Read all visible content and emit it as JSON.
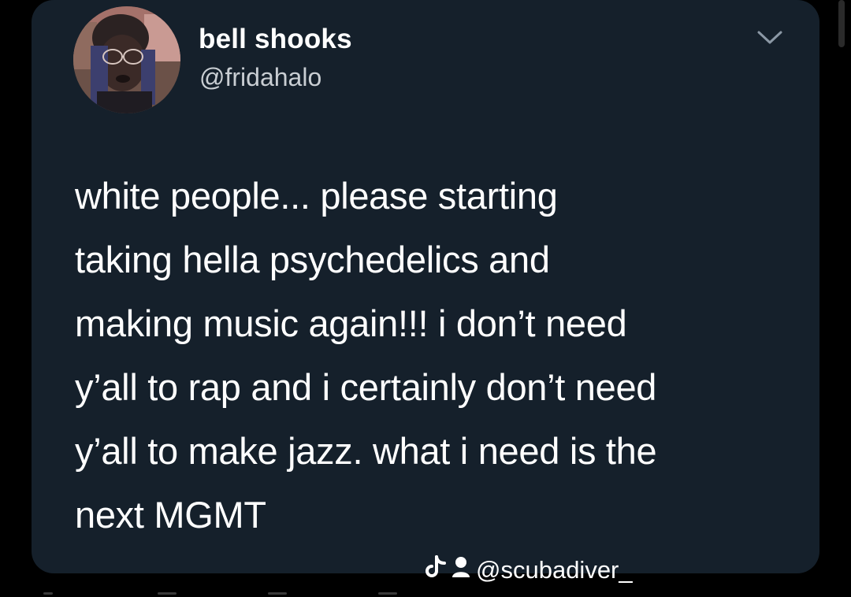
{
  "tweet": {
    "display_name": "bell shooks",
    "handle": "@fridahalo",
    "text": "white people... please starting\ntaking hella psychedelics and\nmaking music again!!! i don’t need\ny’all to rap and i certainly don’t need\ny’all to make jazz. what i need is the\nnext MGMT",
    "avatar_icon": "profile-photo",
    "menu_icon": "chevron-down-icon"
  },
  "watermark": {
    "handle": "@scubadiver_",
    "icons": [
      "tiktok-icon",
      "user-icon"
    ]
  },
  "colors": {
    "page_background": "#000000",
    "card_background": "#15202b",
    "text_primary": "#ffffff",
    "text_secondary": "#c9ced3"
  }
}
